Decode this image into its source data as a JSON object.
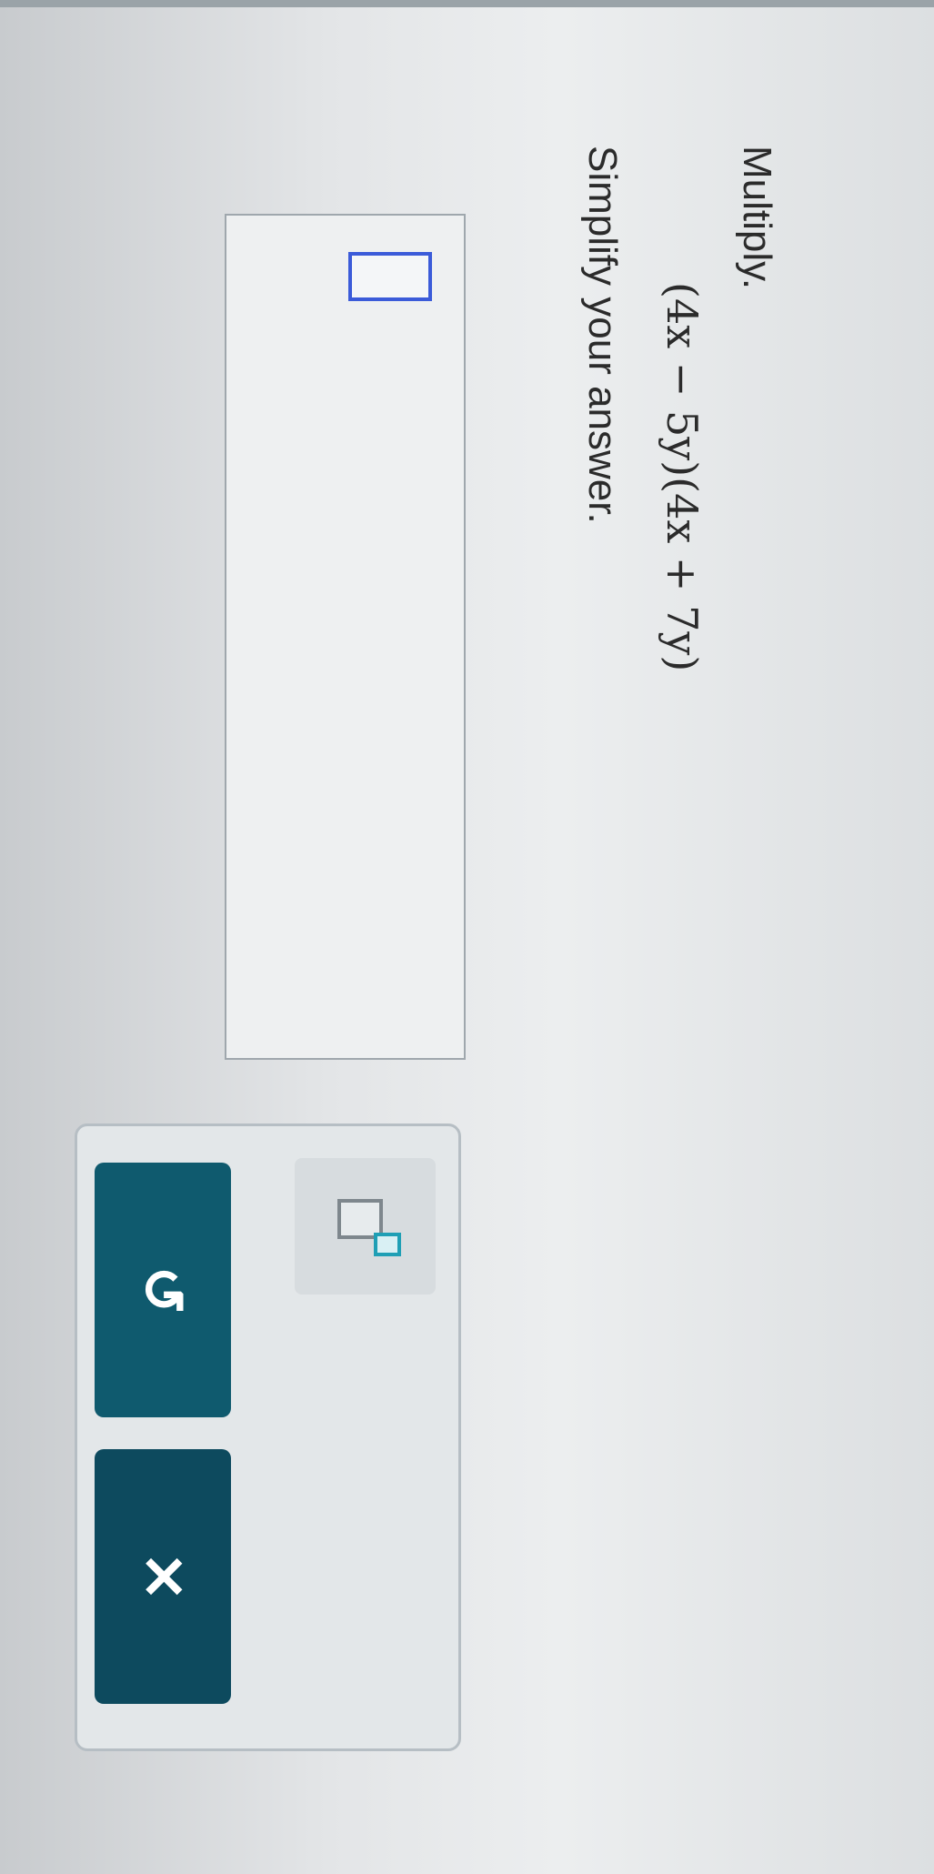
{
  "question": {
    "label": "Multiply.",
    "expression": "(4x − 5y)(4x + 7y)",
    "instruction": "Simplify your answer."
  },
  "answer": {
    "value": ""
  },
  "toolbar": {
    "exponent_icon": "exponent-template-icon",
    "undo_icon": "undo-icon",
    "undo_glyph": "↺",
    "clear_icon": "clear-icon",
    "clear_glyph": "✕"
  },
  "colors": {
    "button_primary": "#0f5a6e",
    "cursor_outline": "#3b5bd9",
    "exponent_accent": "#1f9fb5"
  }
}
